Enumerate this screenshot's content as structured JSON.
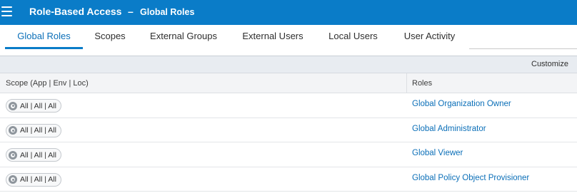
{
  "header": {
    "app_title": "Role-Based Access",
    "separator": "–",
    "page_title": "Global Roles"
  },
  "tabs": [
    {
      "label": "Global Roles",
      "active": true
    },
    {
      "label": "Scopes",
      "active": false
    },
    {
      "label": "External Groups",
      "active": false
    },
    {
      "label": "External Users",
      "active": false
    },
    {
      "label": "Local Users",
      "active": false
    },
    {
      "label": "User Activity",
      "active": false
    }
  ],
  "toolbar": {
    "customize_label": "Customize"
  },
  "table": {
    "columns": {
      "scope": "Scope (App | Env | Loc)",
      "roles": "Roles"
    },
    "rows": [
      {
        "scope": "All | All | All",
        "role": "Global Organization Owner"
      },
      {
        "scope": "All | All | All",
        "role": "Global Administrator"
      },
      {
        "scope": "All | All | All",
        "role": "Global Viewer"
      },
      {
        "scope": "All | All | All",
        "role": "Global Policy Object Provisioner"
      }
    ]
  },
  "colors": {
    "header_bg": "#0a7cc8",
    "accent": "#0b6fb8"
  },
  "icons": {
    "menu": "hamburger-menu-icon",
    "scope": "gear-icon"
  }
}
